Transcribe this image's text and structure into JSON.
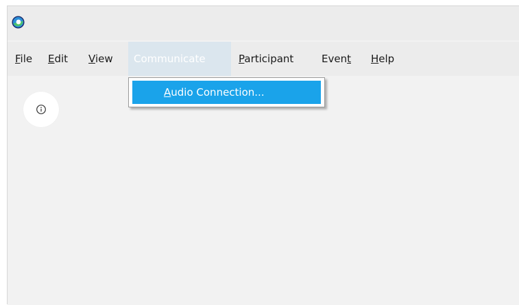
{
  "app": {
    "logo_icon": "webex-logo-icon"
  },
  "menu": {
    "items": [
      {
        "mnemonic": "F",
        "rest": "ile"
      },
      {
        "mnemonic": "E",
        "rest": "dit"
      },
      {
        "mnemonic": "V",
        "rest": "iew"
      },
      {
        "mnemonic": "",
        "rest": "Communicate"
      },
      {
        "mnemonic": "P",
        "rest": "articipant"
      },
      {
        "pre": "Even",
        "mnemonic": "t"
      },
      {
        "mnemonic": "H",
        "rest": "elp"
      }
    ]
  },
  "dropdown": {
    "items": [
      {
        "mnemonic": "A",
        "rest": "udio Connection..."
      }
    ]
  },
  "content": {
    "info_icon": "info-icon"
  },
  "colors": {
    "menu_open_bg": "#dbe6ee",
    "highlight": "#1aa3ea"
  }
}
